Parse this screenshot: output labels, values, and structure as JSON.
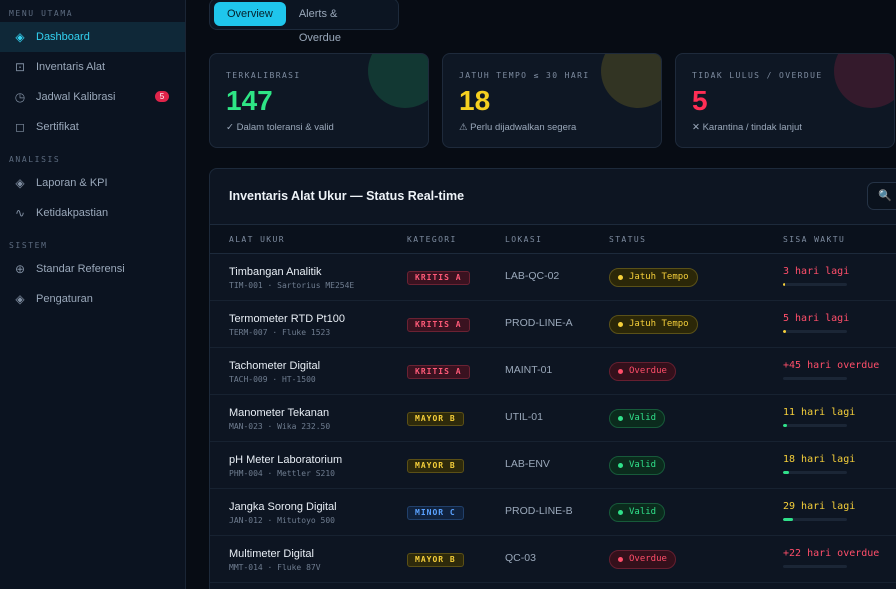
{
  "sidebar": {
    "sections": [
      {
        "title": "MENU UTAMA",
        "items": [
          {
            "label": "Dashboard",
            "icon": "diamond-icon",
            "glyph": "◈"
          },
          {
            "label": "Inventaris Alat",
            "icon": "box-icon",
            "glyph": "⊡"
          },
          {
            "label": "Jadwal Kalibrasi",
            "icon": "clock-icon",
            "glyph": "◷",
            "badge": "5"
          },
          {
            "label": "Sertifikat",
            "icon": "certificate-icon",
            "glyph": "◻"
          }
        ]
      },
      {
        "title": "ANALISIS",
        "items": [
          {
            "label": "Laporan & KPI",
            "icon": "report-icon",
            "glyph": "◈"
          },
          {
            "label": "Ketidakpastian",
            "icon": "wave-icon",
            "glyph": "∿"
          }
        ]
      },
      {
        "title": "SISTEM",
        "items": [
          {
            "label": "Standar Referensi",
            "icon": "target-icon",
            "glyph": "⊕"
          },
          {
            "label": "Pengaturan",
            "icon": "settings-icon",
            "glyph": "◈"
          }
        ]
      }
    ]
  },
  "tabs": [
    "Overview",
    "Alerts & Overdue"
  ],
  "stats": [
    {
      "label": "TERKALIBRASI",
      "value": "147",
      "note": "✓ Dalam toleransi & valid",
      "color": "#2ee585"
    },
    {
      "label": "JATUH TEMPO ≤ 30 HARI",
      "value": "18",
      "note": "⚠ Perlu dijadwalkan segera",
      "color": "#f5d020"
    },
    {
      "label": "TIDAK LULUS / OVERDUE",
      "value": "5",
      "note": "✕ Karantina / tindak lanjut",
      "color": "#ff2e55"
    }
  ],
  "panel": {
    "title": "Inventaris Alat Ukur — Status Real-time",
    "search_glyph": "🔍",
    "columns": [
      "ALAT UKUR",
      "KATEGORI",
      "LOKASI",
      "STATUS",
      "SISA WAKTU"
    ]
  },
  "rows": [
    {
      "name": "Timbangan Analitik",
      "code": "TIM-001 · Sartorius ME254E",
      "category": "KRITIS A",
      "cat_class": "kritis",
      "location": "LAB-QC-02",
      "status": "Jatuh Tempo",
      "status_class": "due",
      "remaining": "3 hari lagi",
      "remaining_color": "#ff4e6a",
      "progress": 0.03,
      "bar_color": "#f5cf3a"
    },
    {
      "name": "Termometer RTD Pt100",
      "code": "TERM-007 · Fluke 1523",
      "category": "KRITIS A",
      "cat_class": "kritis",
      "location": "PROD-LINE-A",
      "status": "Jatuh Tempo",
      "status_class": "due",
      "remaining": "5 hari lagi",
      "remaining_color": "#ff4e6a",
      "progress": 0.04,
      "bar_color": "#f5cf3a"
    },
    {
      "name": "Tachometer Digital",
      "code": "TACH-009 · HT-1500",
      "category": "KRITIS A",
      "cat_class": "kritis",
      "location": "MAINT-01",
      "status": "Overdue",
      "status_class": "over",
      "remaining": "+45 hari overdue",
      "remaining_color": "#ff4e6a",
      "progress": 0,
      "bar_color": "#ff4e6a"
    },
    {
      "name": "Manometer Tekanan",
      "code": "MAN-023 · Wika 232.50",
      "category": "MAYOR B",
      "cat_class": "mayor",
      "location": "UTIL-01",
      "status": "Valid",
      "status_class": "ok",
      "remaining": "11 hari lagi",
      "remaining_color": "#f5cf3a",
      "progress": 0.06,
      "bar_color": "#30e08a"
    },
    {
      "name": "pH Meter Laboratorium",
      "code": "PHM-004 · Mettler S210",
      "category": "MAYOR B",
      "cat_class": "mayor",
      "location": "LAB-ENV",
      "status": "Valid",
      "status_class": "ok",
      "remaining": "18 hari lagi",
      "remaining_color": "#f5cf3a",
      "progress": 0.1,
      "bar_color": "#30e08a"
    },
    {
      "name": "Jangka Sorong Digital",
      "code": "JAN-012 · Mitutoyo 500",
      "category": "MINOR C",
      "cat_class": "minor",
      "location": "PROD-LINE-B",
      "status": "Valid",
      "status_class": "ok",
      "remaining": "29 hari lagi",
      "remaining_color": "#f5cf3a",
      "progress": 0.16,
      "bar_color": "#30e08a"
    },
    {
      "name": "Multimeter Digital",
      "code": "MMT-014 · Fluke 87V",
      "category": "MAYOR B",
      "cat_class": "mayor",
      "location": "QC-03",
      "status": "Overdue",
      "status_class": "over",
      "remaining": "+22 hari overdue",
      "remaining_color": "#ff4e6a",
      "progress": 0,
      "bar_color": "#ff4e6a"
    }
  ]
}
